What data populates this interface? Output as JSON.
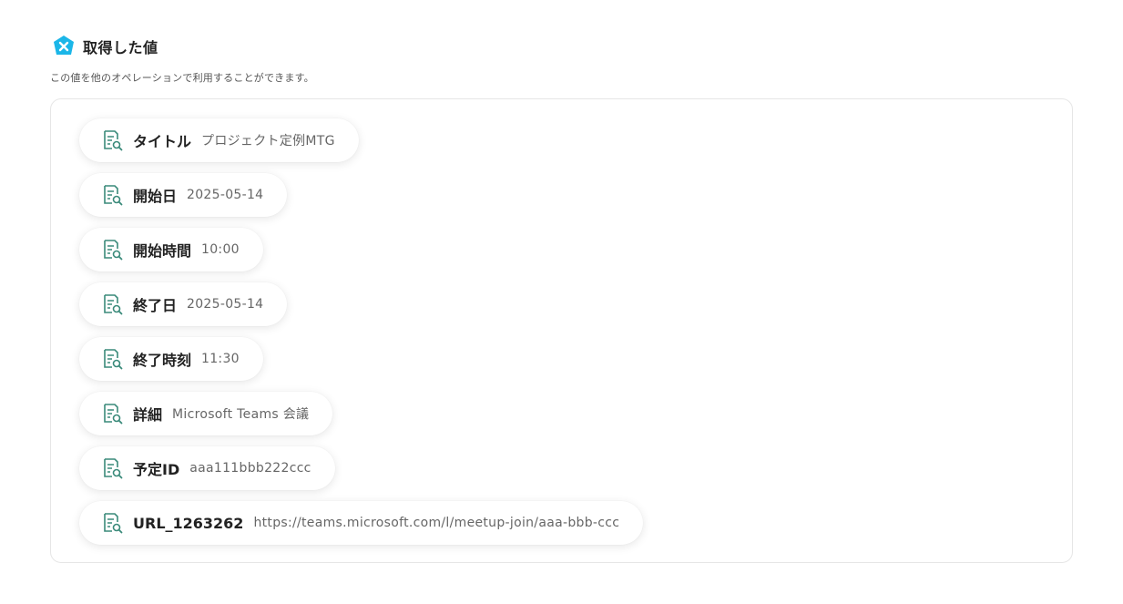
{
  "header": {
    "title": "取得した値",
    "description": "この値を他のオペレーションで利用することができます。",
    "icon": "yoom-logo-icon",
    "brand_color": "#1bb6e8"
  },
  "values": [
    {
      "label": "タイトル",
      "value": "プロジェクト定例MTG",
      "icon": "document-search-icon"
    },
    {
      "label": "開始日",
      "value": "2025-05-14",
      "icon": "document-search-icon"
    },
    {
      "label": "開始時間",
      "value": "10:00",
      "icon": "document-search-icon"
    },
    {
      "label": "終了日",
      "value": "2025-05-14",
      "icon": "document-search-icon"
    },
    {
      "label": "終了時刻",
      "value": "11:30",
      "icon": "document-search-icon"
    },
    {
      "label": "詳細",
      "value": "Microsoft Teams 会議",
      "icon": "document-search-icon"
    },
    {
      "label": "予定ID",
      "value": "aaa111bbb222ccc",
      "icon": "document-search-icon"
    },
    {
      "label": "URL_1263262",
      "value": "https://teams.microsoft.com/l/meetup-join/aaa-bbb-ccc",
      "icon": "document-search-icon"
    }
  ],
  "icon_color": "#3a8a7a"
}
